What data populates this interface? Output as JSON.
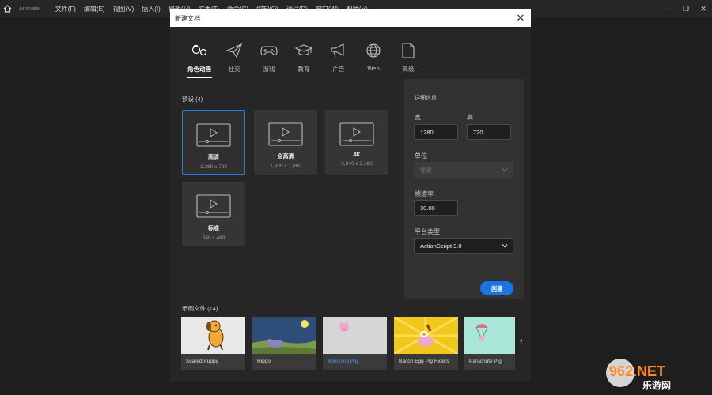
{
  "menubar": {
    "app_name": "Animate",
    "items": [
      "文件(F)",
      "编辑(E)",
      "视图(V)",
      "插入(I)",
      "修改(M)",
      "文本(T)",
      "命令(C)",
      "控制(O)",
      "调试(D)",
      "窗口(W)",
      "帮助(H)"
    ]
  },
  "dialog": {
    "title": "新建文档",
    "tabs": [
      {
        "label": "角色动画",
        "icon": "character-animation-icon",
        "active": true
      },
      {
        "label": "社交",
        "icon": "paper-plane-icon",
        "active": false
      },
      {
        "label": "游戏",
        "icon": "gamepad-icon",
        "active": false
      },
      {
        "label": "教育",
        "icon": "graduation-cap-icon",
        "active": false
      },
      {
        "label": "广告",
        "icon": "megaphone-icon",
        "active": false
      },
      {
        "label": "Web",
        "icon": "globe-icon",
        "active": false
      },
      {
        "label": "高级",
        "icon": "document-icon",
        "active": false
      }
    ],
    "presets_title": "预设 (4)",
    "presets": [
      {
        "name": "高清",
        "size": "1,280 x 720",
        "selected": true
      },
      {
        "name": "全高清",
        "size": "1,920 x 1,080",
        "selected": false
      },
      {
        "name": "4K",
        "size": "3,840 x 2,160",
        "selected": false
      },
      {
        "name": "标准",
        "size": "640 x 480",
        "selected": false
      }
    ],
    "details": {
      "title": "详细信息",
      "width_label": "宽",
      "width_value": "1280",
      "height_label": "高",
      "height_value": "720",
      "unit_label": "单位",
      "unit_value": "像素",
      "fps_label": "帧速率",
      "fps_value": "30.00",
      "platform_label": "平台类型",
      "platform_value": "ActionScript 3.0",
      "create_label": "创建"
    },
    "samples_title": "示例文件 (14)",
    "samples": [
      {
        "name": "Scared Puppy"
      },
      {
        "name": "Hippo"
      },
      {
        "name": "Bouncing Pig"
      },
      {
        "name": "Bacon Egg Pig Riders"
      },
      {
        "name": "Parachute Pig"
      }
    ]
  },
  "watermark": {
    "brand": "962.NET",
    "sub": "乐游网"
  },
  "colors": {
    "accent": "#1b73e8",
    "selected_border": "#2d7be0",
    "background": "#1e1e1e",
    "panel": "#262626",
    "details_panel": "#323232"
  }
}
